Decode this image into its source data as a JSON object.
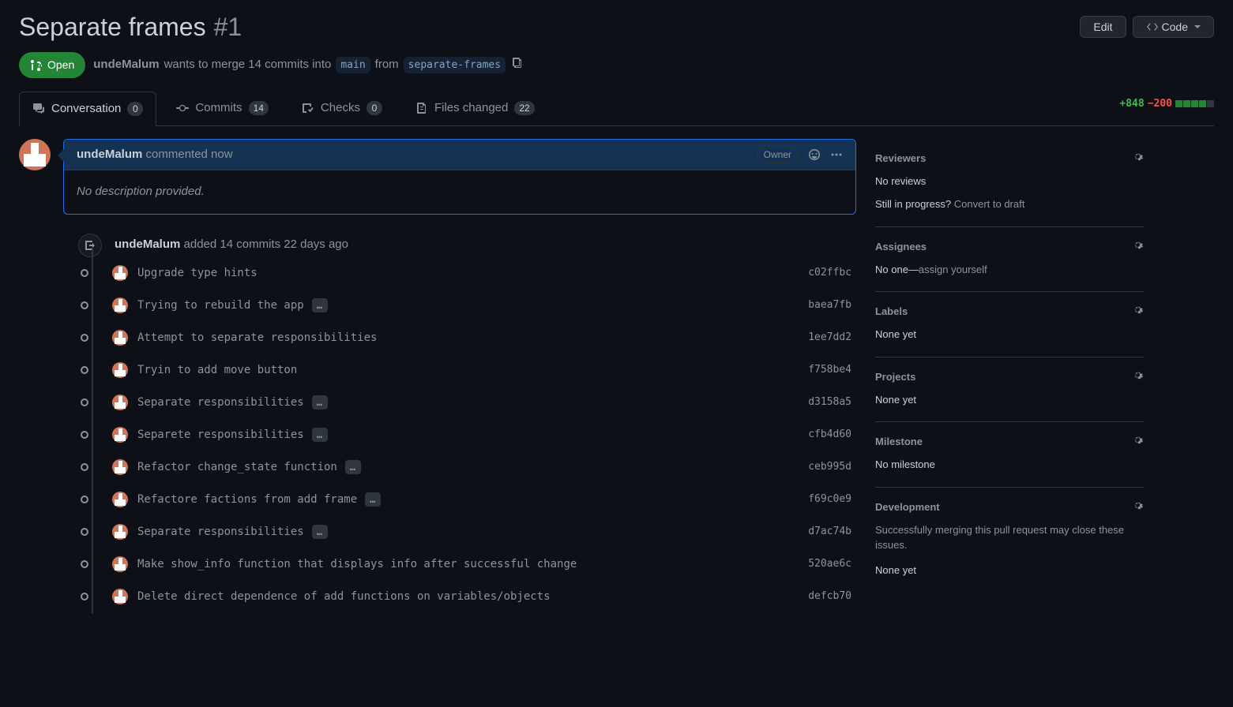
{
  "header": {
    "title": "Separate frames",
    "number": "#1",
    "edit_label": "Edit",
    "code_label": "Code"
  },
  "state": {
    "label": "Open"
  },
  "merge": {
    "author": "undeMalum",
    "text1": "wants to merge 14 commits into",
    "into_branch": "main",
    "from_word": "from",
    "from_branch": "separate-frames"
  },
  "tabs": {
    "conversation": {
      "label": "Conversation",
      "count": "0"
    },
    "commits": {
      "label": "Commits",
      "count": "14"
    },
    "checks": {
      "label": "Checks",
      "count": "0"
    },
    "files": {
      "label": "Files changed",
      "count": "22"
    }
  },
  "diff": {
    "add": "+848",
    "del": "−200"
  },
  "comment": {
    "author": "undeMalum",
    "meta": "commented now",
    "owner": "Owner",
    "body": "No description provided."
  },
  "push": {
    "author": "undeMalum",
    "text": "added 14 commits 22 days ago"
  },
  "commits": [
    {
      "msg": "Upgrade type hints",
      "has_more": false,
      "sha": "c02ffbc"
    },
    {
      "msg": "Trying to rebuild the app",
      "has_more": true,
      "sha": "baea7fb"
    },
    {
      "msg": "Attempt to separate responsibilities",
      "has_more": false,
      "sha": "1ee7dd2"
    },
    {
      "msg": "Tryin to add move button",
      "has_more": false,
      "sha": "f758be4"
    },
    {
      "msg": "Separate responsibilities",
      "has_more": true,
      "sha": "d3158a5"
    },
    {
      "msg": "Separete responsibilities",
      "has_more": true,
      "sha": "cfb4d60"
    },
    {
      "msg": "Refactor change_state function",
      "has_more": true,
      "sha": "ceb995d"
    },
    {
      "msg": "Refactore factions from add frame",
      "has_more": true,
      "sha": "f69c0e9"
    },
    {
      "msg": "Separate responsibilities",
      "has_more": true,
      "sha": "d7ac74b"
    },
    {
      "msg": "Make show_info function that displays info after successful change",
      "has_more": false,
      "sha": "520ae6c"
    },
    {
      "msg": "Delete direct dependence of add functions on variables/objects",
      "has_more": false,
      "sha": "defcb70"
    }
  ],
  "sidebar": {
    "reviewers": {
      "title": "Reviewers",
      "body": "No reviews",
      "progress_prefix": "Still in progress?",
      "progress_link": "Convert to draft"
    },
    "assignees": {
      "title": "Assignees",
      "body_prefix": "No one—",
      "body_link": "assign yourself"
    },
    "labels": {
      "title": "Labels",
      "body": "None yet"
    },
    "projects": {
      "title": "Projects",
      "body": "None yet"
    },
    "milestone": {
      "title": "Milestone",
      "body": "No milestone"
    },
    "development": {
      "title": "Development",
      "body": "Successfully merging this pull request may close these issues.",
      "body2": "None yet"
    }
  }
}
